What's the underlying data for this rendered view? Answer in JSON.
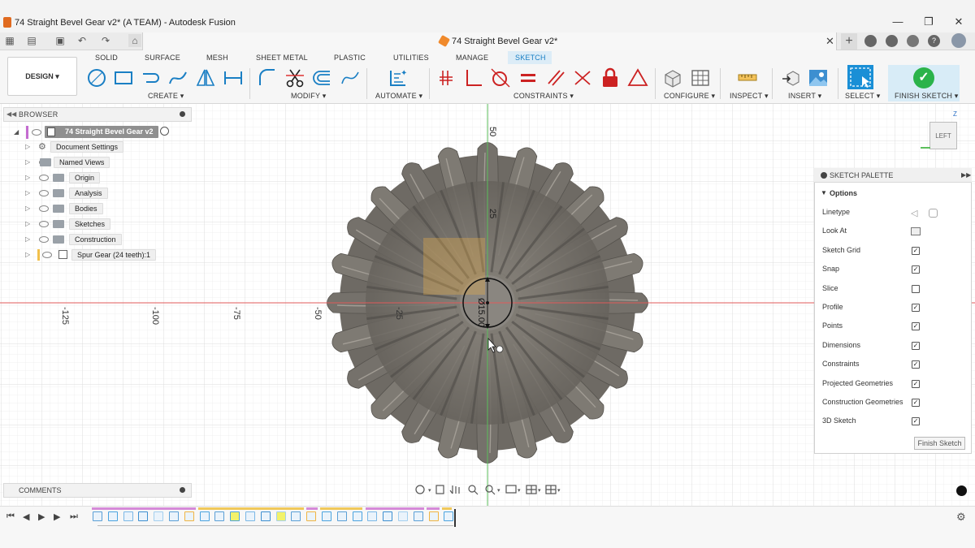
{
  "window": {
    "title": "74 Straight Bevel Gear v2* (A TEAM) - Autodesk Fusion",
    "minimize": "—",
    "maximize": "❐",
    "close": "✕"
  },
  "document_tab": {
    "label": "74 Straight Bevel Gear v2*",
    "close": "✕",
    "add": "+"
  },
  "workspace": {
    "label": "DESIGN ▾"
  },
  "toolbar_tabs": [
    "SOLID",
    "SURFACE",
    "MESH",
    "SHEET METAL",
    "PLASTIC",
    "UTILITIES",
    "MANAGE",
    "SKETCH"
  ],
  "active_tab": "SKETCH",
  "groups": {
    "create": "CREATE ▾",
    "modify": "MODIFY ▾",
    "automate": "AUTOMATE ▾",
    "constraints": "CONSTRAINTS ▾",
    "configure": "CONFIGURE ▾",
    "inspect": "INSPECT ▾",
    "insert": "INSERT ▾",
    "select": "SELECT ▾",
    "finish": "FINISH SKETCH ▾"
  },
  "browser": {
    "title": "BROWSER",
    "root": "74 Straight Bevel Gear v2",
    "items": [
      {
        "label": "Document Settings",
        "icon": "gear-icon"
      },
      {
        "label": "Named Views",
        "icon": "folder-icon"
      },
      {
        "label": "Origin",
        "icon": "folder-icon"
      },
      {
        "label": "Analysis",
        "icon": "folder-icon"
      },
      {
        "label": "Bodies",
        "icon": "folder-icon"
      },
      {
        "label": "Sketches",
        "icon": "folder-icon"
      },
      {
        "label": "Construction",
        "icon": "folder-icon"
      },
      {
        "label": "Spur Gear (24 teeth):1",
        "icon": "component-icon"
      }
    ]
  },
  "comments": {
    "title": "COMMENTS"
  },
  "viewcube": {
    "face": "LEFT",
    "axis_z": "Z"
  },
  "axis_labels": {
    "x": [
      "-125",
      "-100",
      "-75",
      "-50",
      "-25"
    ],
    "y": [
      "50",
      "25"
    ],
    "dimension": "Ø15.00"
  },
  "sketch_palette": {
    "title": "SKETCH PALETTE",
    "section": "Options",
    "rows": [
      {
        "label": "Linetype",
        "type": "icons"
      },
      {
        "label": "Look At",
        "type": "icon"
      },
      {
        "label": "Sketch Grid",
        "checked": true
      },
      {
        "label": "Snap",
        "checked": true
      },
      {
        "label": "Slice",
        "checked": false
      },
      {
        "label": "Profile",
        "checked": true
      },
      {
        "label": "Points",
        "checked": true
      },
      {
        "label": "Dimensions",
        "checked": true
      },
      {
        "label": "Constraints",
        "checked": true
      },
      {
        "label": "Projected Geometries",
        "checked": true
      },
      {
        "label": "Construction Geometries",
        "checked": true
      },
      {
        "label": "3D Sketch",
        "checked": true
      }
    ],
    "finish_button": "Finish Sketch"
  },
  "colors": {
    "accent": "#1a8fd6",
    "finish_green": "#2bb34a",
    "gear": "#7b7770",
    "x_axis": "#e05a5a",
    "y_axis": "#5bbf5b"
  }
}
